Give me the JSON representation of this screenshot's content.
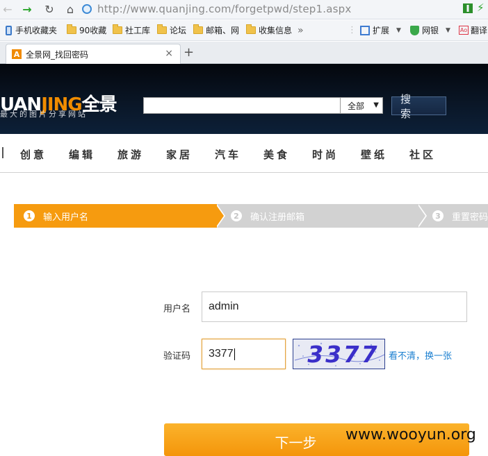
{
  "browser": {
    "url": "http://www.quanjing.com/forgetpwd/step1.aspx",
    "bookmarks": [
      "手机收藏夹",
      "90收藏",
      "社工库",
      "论坛",
      "邮箱、网",
      "收集信息"
    ],
    "more_glyph": "»",
    "extensions": [
      "扩展",
      "网银",
      "翻译"
    ],
    "tab_title": "全景网_找回密码",
    "tab_favicon": "A",
    "tab_close": "×",
    "new_tab": "+"
  },
  "header": {
    "logo_main": "UAN",
    "logo_accent": "JING",
    "logo_cn": "全景",
    "logo_tagline": "最大的图片分享网站",
    "search_value": "",
    "search_scope": "全部",
    "search_button": "搜 索"
  },
  "nav": [
    "创意",
    "编辑",
    "旅游",
    "家居",
    "汽车",
    "美食",
    "时尚",
    "壁纸",
    "社区"
  ],
  "steps": [
    {
      "num": "1",
      "label": "输入用户名",
      "active": true
    },
    {
      "num": "2",
      "label": "确认注册邮箱",
      "active": false
    },
    {
      "num": "3",
      "label": "重置密码",
      "active": false
    }
  ],
  "form": {
    "username_label": "用户名",
    "username_value": "admin",
    "captcha_label": "验证码",
    "captcha_value": "3377",
    "captcha_image_text": "3377",
    "refresh_link": "看不清，换一张",
    "next_button": "下一步"
  },
  "watermark": "www.wooyun.org",
  "colors": {
    "accent": "#f69b0f",
    "inactive_step": "#d2d2d2",
    "link": "#1a7fd0"
  }
}
